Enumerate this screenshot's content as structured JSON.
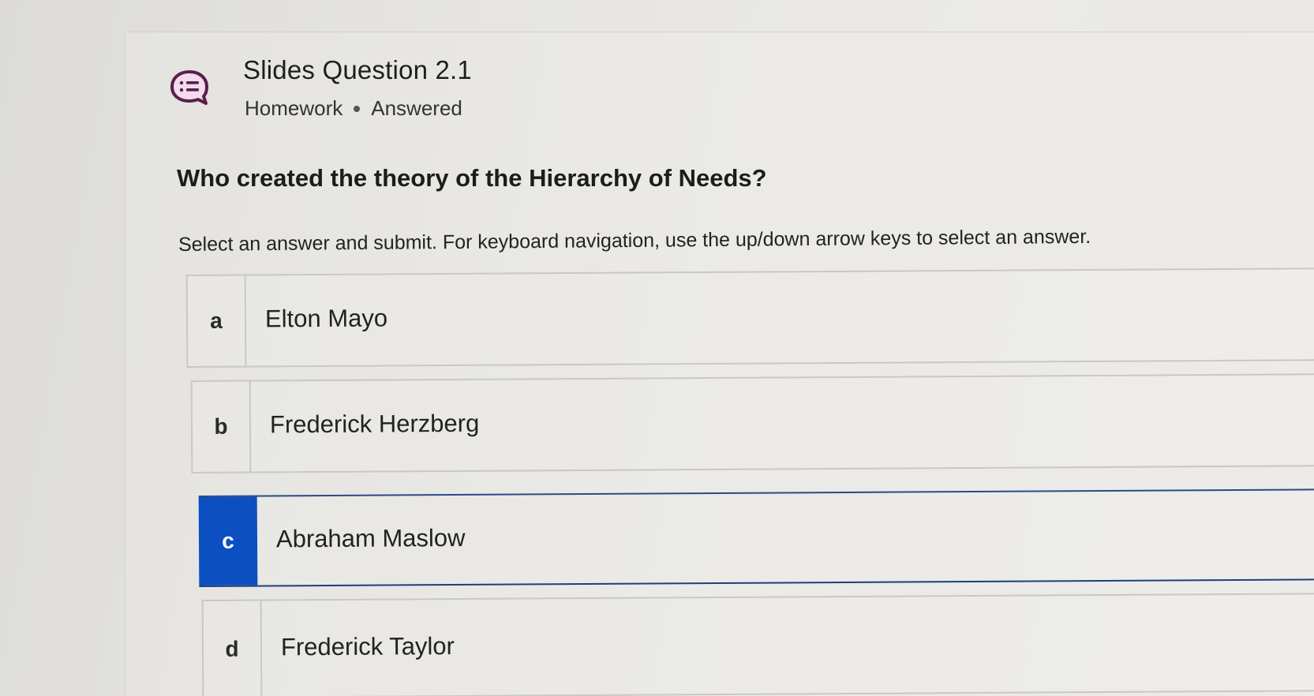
{
  "header": {
    "icon": "chat-list-icon",
    "title": "Slides Question 2.1",
    "category": "Homework",
    "status": "Answered"
  },
  "question": {
    "text": "Who created the theory of the Hierarchy of Needs?",
    "instructions": "Select an answer and submit. For keyboard navigation, use the up/down arrow keys to select an answer."
  },
  "options": [
    {
      "letter": "a",
      "label": "Elton Mayo",
      "selected": false
    },
    {
      "letter": "b",
      "label": "Frederick Herzberg",
      "selected": false
    },
    {
      "letter": "c",
      "label": "Abraham Maslow",
      "selected": true
    },
    {
      "letter": "d",
      "label": "Frederick Taylor",
      "selected": false
    }
  ],
  "colors": {
    "icon_accent": "#5a1f4d",
    "icon_fill": "#f3dceb",
    "selected_accent": "#0b4fc1"
  }
}
